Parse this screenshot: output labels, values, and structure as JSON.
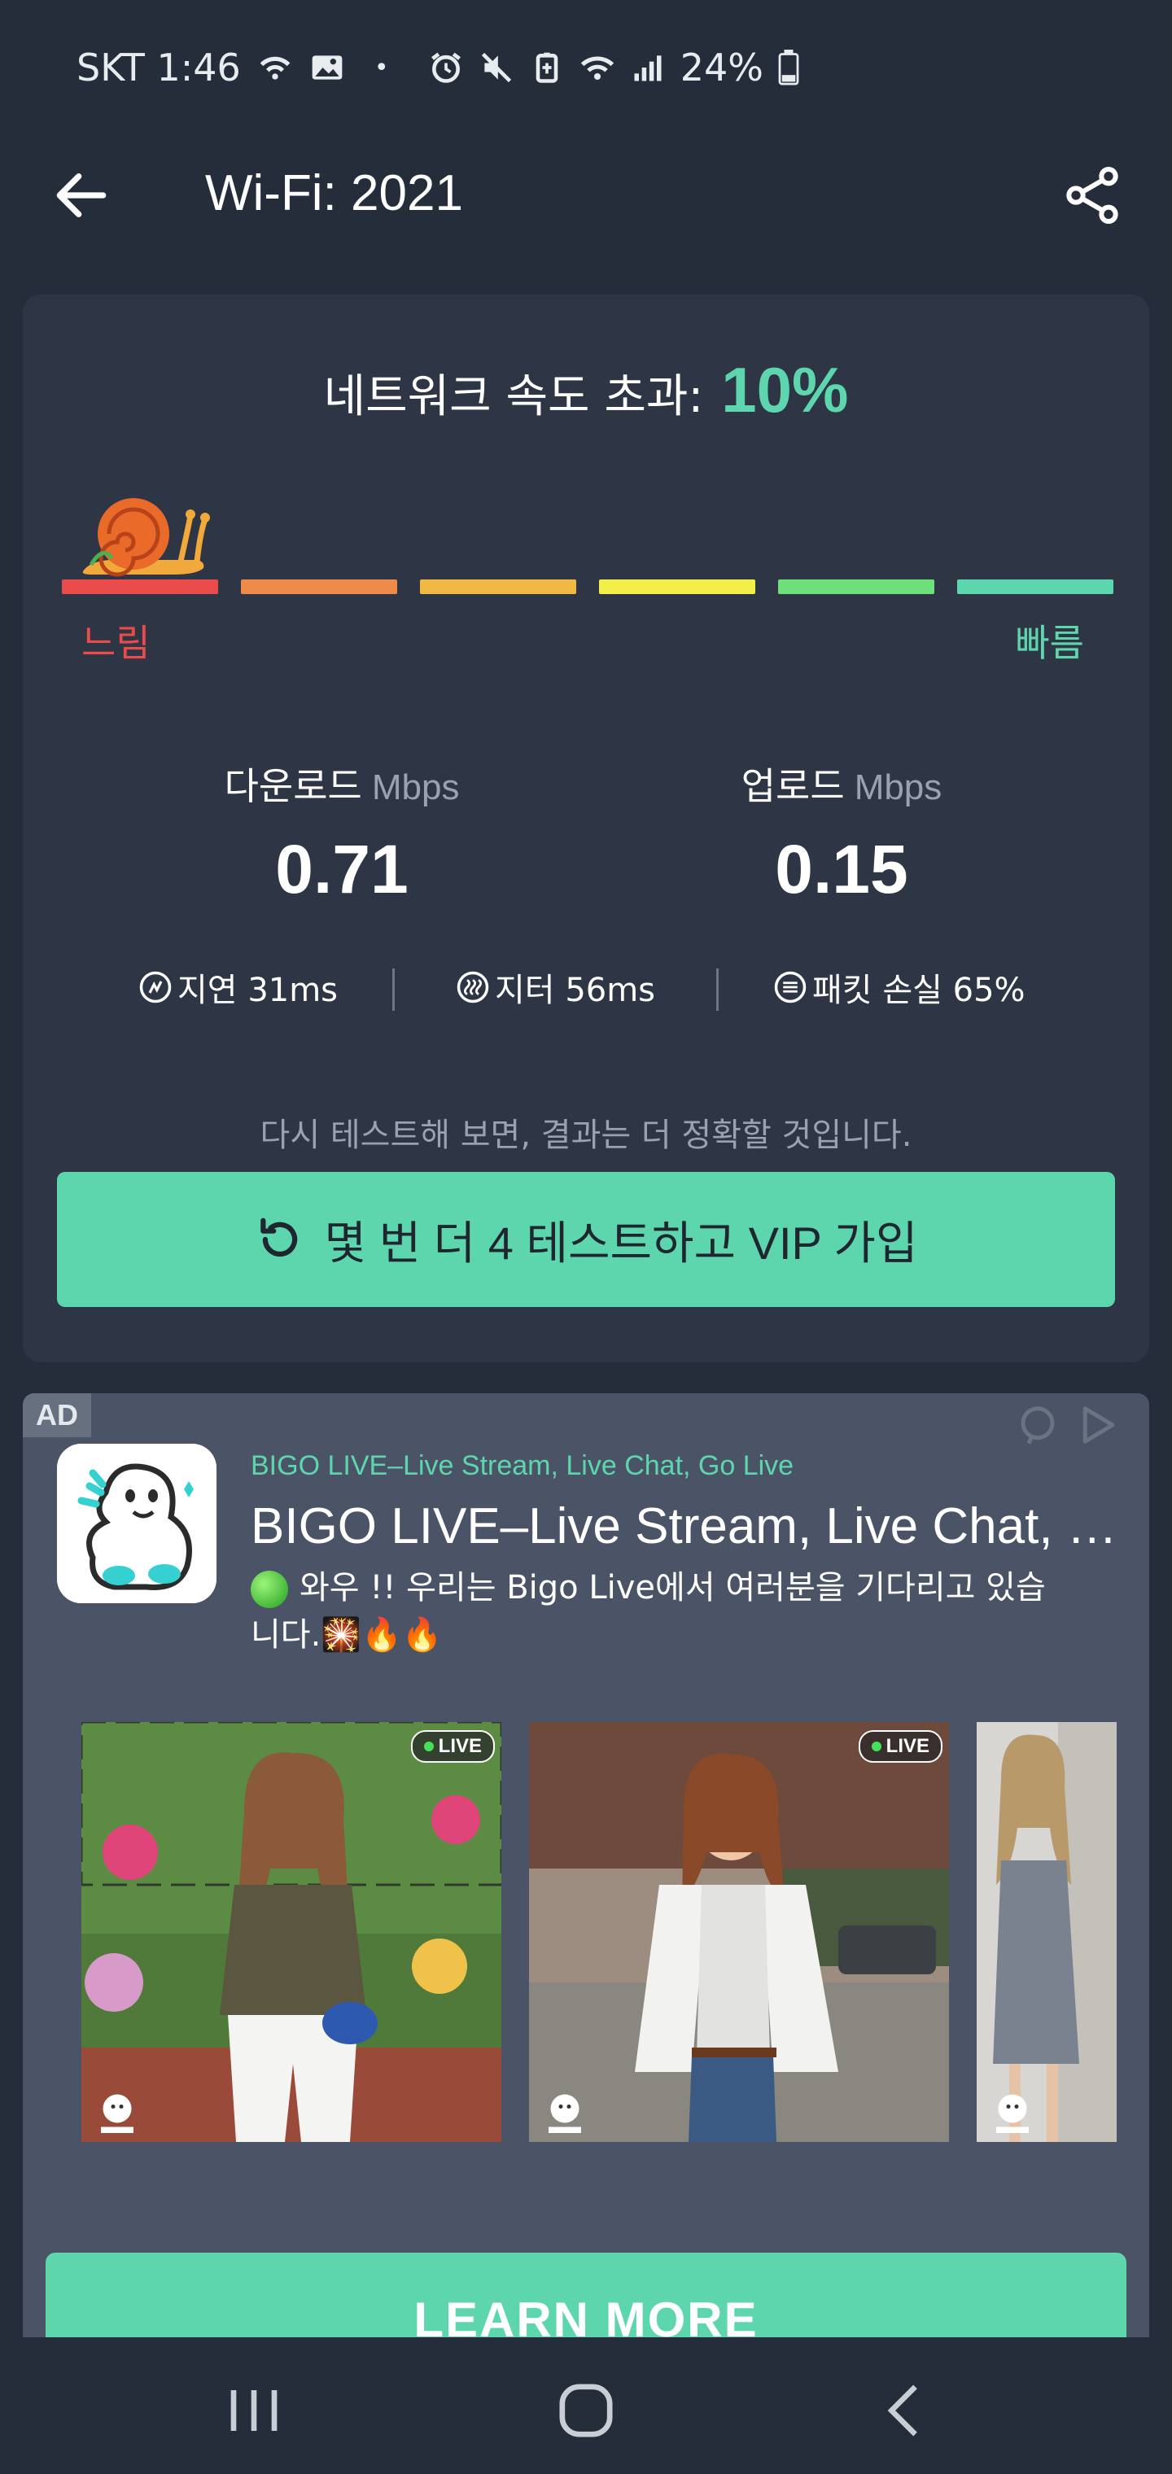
{
  "status_bar": {
    "carrier_time": "SKT 1:46",
    "dot": "•",
    "battery": "24%",
    "icons_left": [
      "wifi-calling-icon",
      "gallery-icon"
    ],
    "icons_right": [
      "alarm-icon",
      "mute-icon",
      "battery-saver-icon",
      "wifi-icon",
      "signal-icon",
      "battery-icon"
    ]
  },
  "app_bar": {
    "title": "Wi-Fi: 2021",
    "back_icon": "arrow-left-icon",
    "share_icon": "share-icon"
  },
  "result": {
    "heading": "네트워크 속도 초과:",
    "percent": "10%",
    "scale_colors": [
      "#ea4b4b",
      "#ee8a4a",
      "#f0b944",
      "#f4ef48",
      "#6ee07a",
      "#5ed6ad"
    ],
    "slow_label": "느림",
    "fast_label": "빠름",
    "download": {
      "label": "다운로드",
      "unit": "Mbps",
      "value": "0.71"
    },
    "upload": {
      "label": "업로드",
      "unit": "Mbps",
      "value": "0.15"
    },
    "stats": {
      "latency": "지연 31ms",
      "jitter": "지터 56ms",
      "packet_loss": "패킷 손실 65%"
    },
    "hint": "다시 테스트해 보면, 결과는 더 정확할 것입니다.",
    "retest_button": "몇 번 더 4 테스트하고 VIP 가입",
    "accent": "#5ed6ad"
  },
  "ad": {
    "tag": "AD",
    "sponsor": "BIGO LIVE–Live Stream, Live Chat, Go Live",
    "title": "BIGO LIVE–Live Stream, Live Chat, Go Live",
    "body": "와우 !! 우리는 Bigo Live에서 여러분을 기다리고 있습니다.🎇🔥🔥",
    "live_badges": [
      "LIVE",
      "LIVE"
    ],
    "cta": "LEARN MORE"
  },
  "nav_bar": {
    "buttons": [
      "recent-apps-icon",
      "home-icon",
      "back-icon"
    ]
  }
}
